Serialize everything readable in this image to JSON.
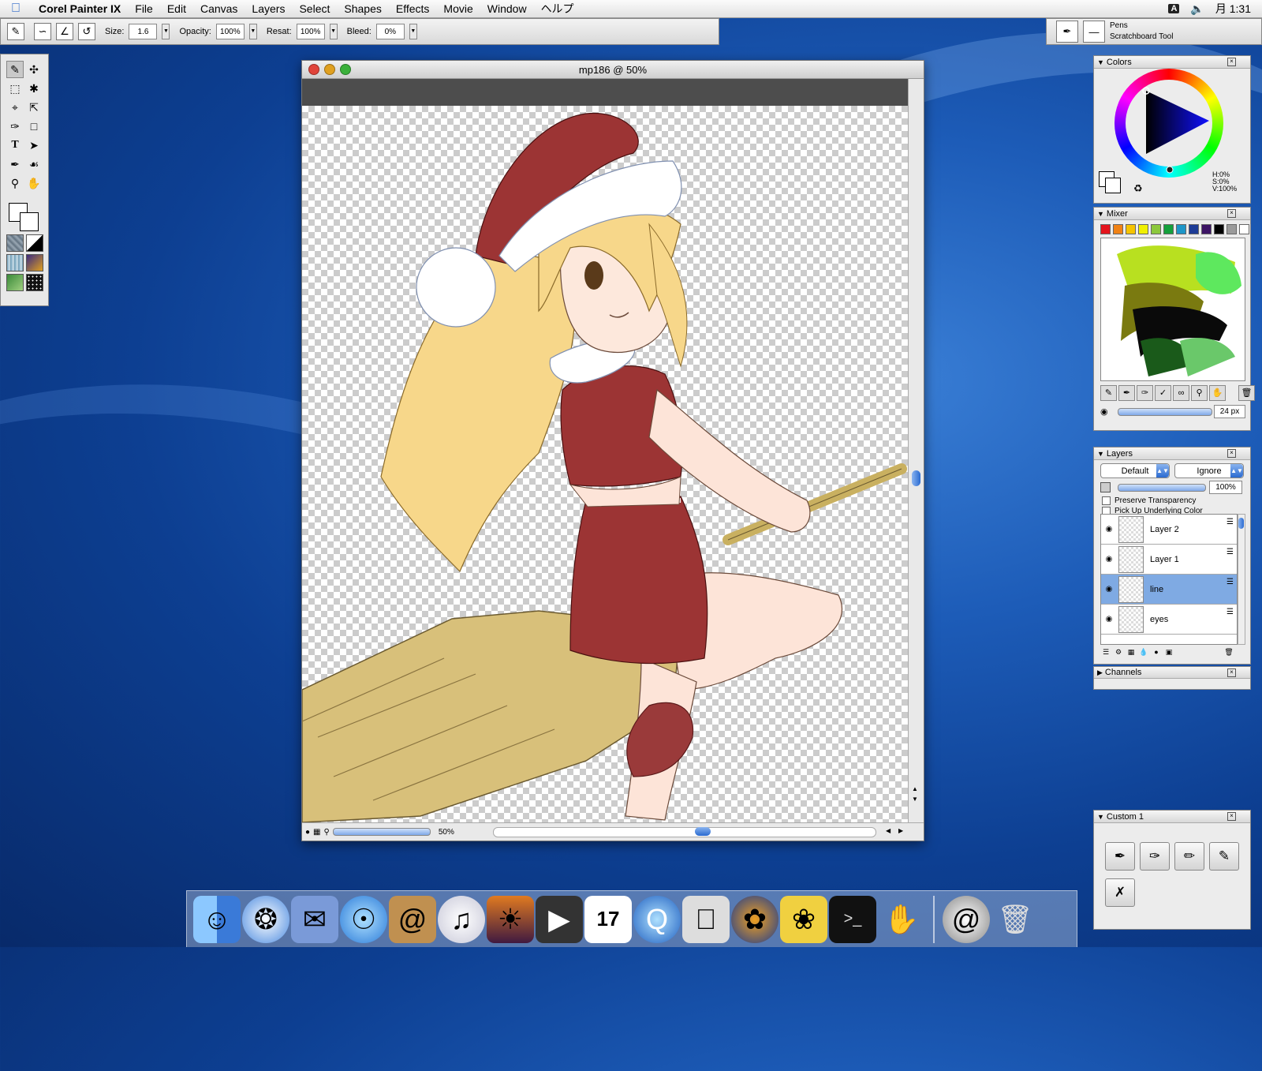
{
  "menubar": {
    "app_name": "Corel Painter IX",
    "items": [
      "File",
      "Edit",
      "Canvas",
      "Layers",
      "Select",
      "Shapes",
      "Effects",
      "Movie",
      "Window",
      "ヘルプ"
    ],
    "input_indicator": "A",
    "clock": "月 1:31"
  },
  "property_bar": {
    "size_label": "Size:",
    "size_value": "1.6",
    "opacity_label": "Opacity:",
    "opacity_value": "100%",
    "resat_label": "Resat:",
    "resat_value": "100%",
    "bleed_label": "Bleed:",
    "bleed_value": "0%"
  },
  "brush_selector": {
    "category": "Pens",
    "variant": "Scratchboard Tool"
  },
  "document": {
    "title": "mp186 @ 50%",
    "zoom": "50%"
  },
  "colors_palette": {
    "title": "Colors",
    "h": "H:0%",
    "s": "S:0%",
    "v": "V:100%"
  },
  "mixer_palette": {
    "title": "Mixer",
    "brush_size": "24 px",
    "swatches": [
      "#e4141c",
      "#f08214",
      "#f6c400",
      "#f0f000",
      "#8cc83c",
      "#14a03c",
      "#1e96c8",
      "#1e3c96",
      "#3c1464",
      "#000000",
      "#9a9a9a",
      "#ffffff"
    ]
  },
  "layers_palette": {
    "title": "Layers",
    "composite_method": "Default",
    "composite_depth": "Ignore",
    "opacity": "100%",
    "preserve_transparency": "Preserve Transparency",
    "pick_up_underlying": "Pick Up Underlying Color",
    "layers": [
      {
        "name": "Layer 2",
        "selected": false
      },
      {
        "name": "Layer 1",
        "selected": false
      },
      {
        "name": "line",
        "selected": true
      },
      {
        "name": "eyes",
        "selected": false
      }
    ]
  },
  "channels_palette": {
    "title": "Channels"
  },
  "custom_palette": {
    "title": "Custom 1"
  }
}
